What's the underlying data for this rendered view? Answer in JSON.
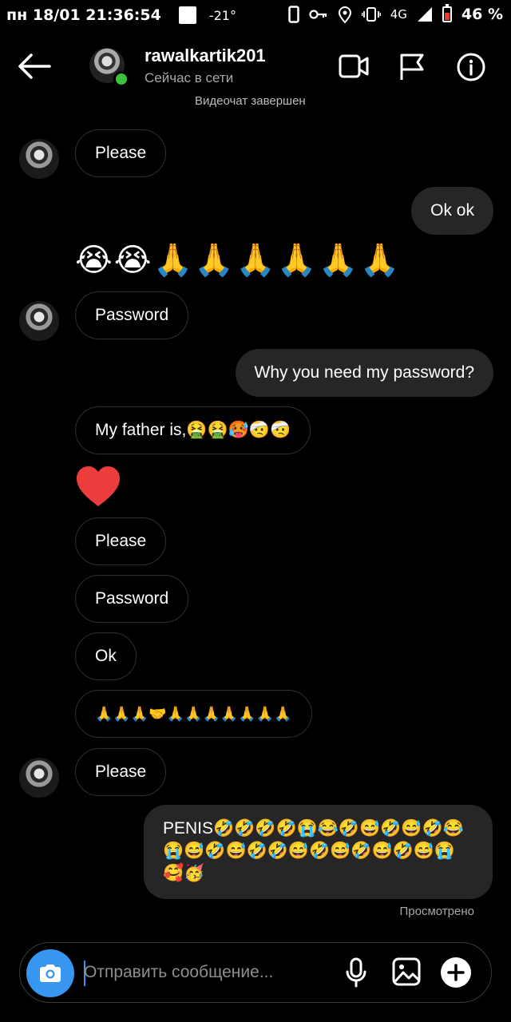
{
  "status_bar": {
    "datetime": "пн 18/01 21:36:54",
    "temperature": "-21°",
    "network": "4G",
    "battery": "46 %",
    "battery_level_percent": 46
  },
  "header": {
    "username": "rawalkartik201",
    "presence": "Сейчас в сети",
    "icons": [
      "back-arrow-icon",
      "video-call-icon",
      "flag-icon",
      "info-icon"
    ]
  },
  "system_note": "Видеочат завершен",
  "messages": [
    {
      "from": "them",
      "text": "Please"
    },
    {
      "from": "me",
      "text": "Ok ok"
    },
    {
      "from": "them",
      "text": "😭😭🙏🙏🙏🙏🙏🙏"
    },
    {
      "from": "them",
      "text": "Password"
    },
    {
      "from": "me",
      "text": "Why you need my password?"
    },
    {
      "from": "them",
      "text": "My father is,🤮🤮🥵🤕🤕"
    },
    {
      "from": "them",
      "text": "❤"
    },
    {
      "from": "them",
      "text": "Please"
    },
    {
      "from": "them",
      "text": "Password"
    },
    {
      "from": "them",
      "text": "Ok"
    },
    {
      "from": "them",
      "text": "🙏🙏🙏🤝🙏🙏🙏🙏🙏🙏🙏"
    },
    {
      "from": "them",
      "text": "Please"
    },
    {
      "from": "me",
      "text": "PENIS🤣🤣🤣🤣😭😂🤣😅🤣😅🤣😂😭😅🤣😅🤣🤣😅🤣😅🤣😅🤣😅😭🥰🥳"
    }
  ],
  "seen_label": "Просмотрено",
  "composer": {
    "placeholder": "Отправить сообщение...",
    "icons": [
      "camera-icon",
      "microphone-icon",
      "gallery-icon",
      "add-icon"
    ]
  },
  "colors": {
    "background": "#000000",
    "outgoing_bubble": "#262626",
    "incoming_border": "#2f2f2f",
    "accent_blue": "#3797f0",
    "online_green": "#3cc13b",
    "heart_red": "#ed3c3c"
  }
}
